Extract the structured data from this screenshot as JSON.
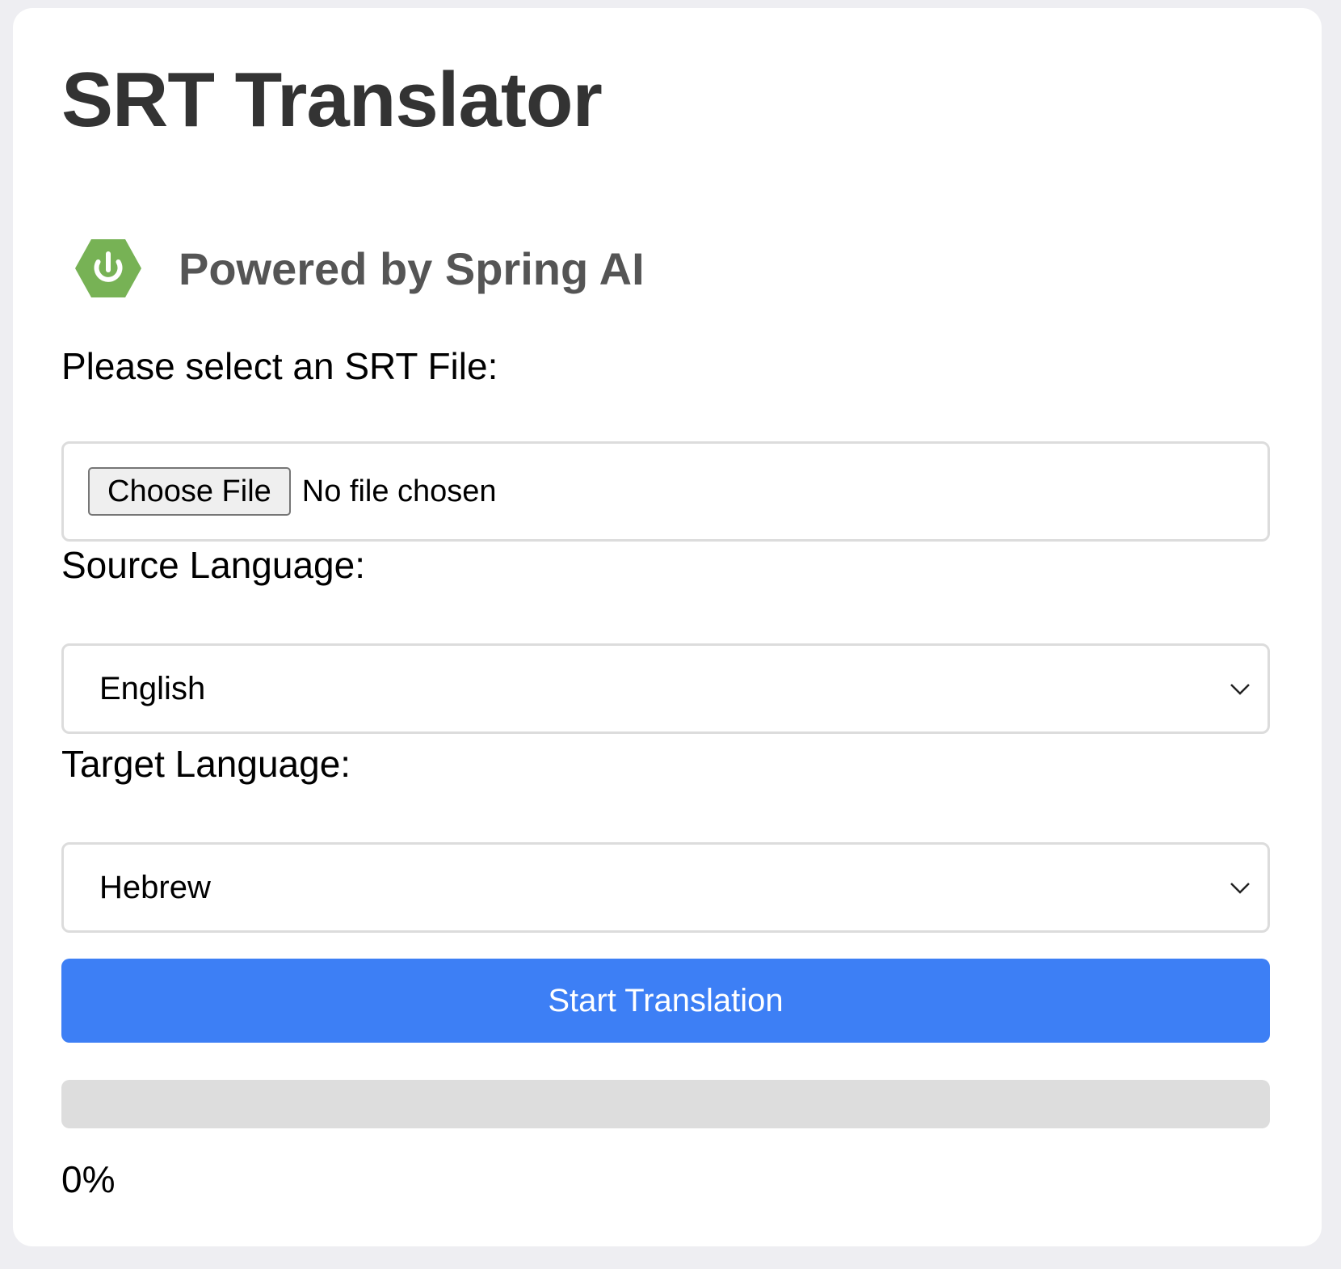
{
  "page": {
    "title": "SRT Translator",
    "powered_by": "Powered by Spring AI"
  },
  "file_input": {
    "label": "Please select an SRT File:",
    "button_label": "Choose File",
    "status": "No file chosen"
  },
  "source_language": {
    "label": "Source Language:",
    "selected": "English"
  },
  "target_language": {
    "label": "Target Language:",
    "selected": "Hebrew"
  },
  "action": {
    "start_label": "Start Translation"
  },
  "progress": {
    "percent": 0,
    "text": "0%"
  },
  "icons": {
    "logo": "spring-power-icon",
    "dropdown": "chevron-down-icon"
  },
  "colors": {
    "accent": "#3d7ff5",
    "spring_green": "#6db33f",
    "track": "#dddddd"
  }
}
